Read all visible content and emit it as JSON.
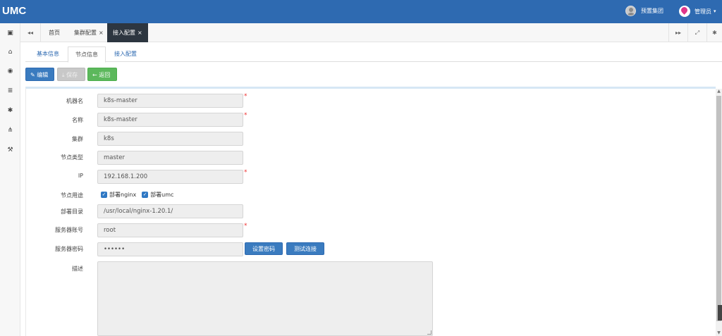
{
  "app": {
    "title": "UMC"
  },
  "header": {
    "org_label": "预置集团",
    "user_label": "管理员",
    "caret": "▾"
  },
  "sidebar": {
    "items": [
      {
        "icon": "id-card-icon",
        "glyph": "▣"
      },
      {
        "icon": "bank-icon",
        "glyph": "⌂"
      },
      {
        "icon": "eye-icon",
        "glyph": "◉"
      },
      {
        "icon": "list-icon",
        "glyph": "≣"
      },
      {
        "icon": "gear-icon",
        "glyph": "✱"
      },
      {
        "icon": "sitemap-icon",
        "glyph": "⋔"
      },
      {
        "icon": "wrench-icon",
        "glyph": "⚒"
      }
    ]
  },
  "tabs": {
    "back_glyph": "◂◂",
    "items": [
      {
        "label": "首页",
        "closable": false,
        "active": false
      },
      {
        "label": "集群配置",
        "closable": true,
        "active": false
      },
      {
        "label": "接入配置",
        "closable": true,
        "active": true
      }
    ],
    "close_glyph": "×",
    "forward_glyph": "▸▸",
    "fullscreen_glyph": "⤢",
    "settings_glyph": "✱"
  },
  "subtabs": [
    {
      "label": "基本信息",
      "active": false
    },
    {
      "label": "节点信息",
      "active": true
    },
    {
      "label": "接入配置",
      "active": false
    }
  ],
  "toolbar": {
    "edit_label": "编辑",
    "edit_icon": "✎",
    "save_label": "保存",
    "save_icon": "⤓",
    "back_label": "返回",
    "back_icon": "←"
  },
  "form": {
    "fields": [
      {
        "label": "机器名",
        "value": "k8s-master",
        "required": true
      },
      {
        "label": "名称",
        "value": "k8s-master",
        "required": true
      },
      {
        "label": "集群",
        "value": "k8s",
        "required": false
      },
      {
        "label": "节点类型",
        "value": "master",
        "required": false
      },
      {
        "label": "IP",
        "value": "192.168.1.200",
        "required": true
      }
    ],
    "usage": {
      "label": "节点用途",
      "options": [
        {
          "label": "部署nginx",
          "checked": true
        },
        {
          "label": "部署umc",
          "checked": true
        }
      ]
    },
    "deploy_dir": {
      "label": "部署目录",
      "value": "/usr/local/nginx-1.20.1/"
    },
    "account": {
      "label": "服务器账号",
      "value": "root",
      "required": true
    },
    "password": {
      "label": "服务器密码",
      "value": "••••••"
    },
    "set_password_label": "设置密码",
    "test_connection_label": "测试连接",
    "description": {
      "label": "描述",
      "value": ""
    },
    "required_mark": "*"
  },
  "colors": {
    "topbar": "#2e6ab1",
    "active_tab": "#2d3640",
    "primary_button": "#3a7bbf",
    "back_button": "#5cb85c",
    "required": "#ee3333"
  }
}
